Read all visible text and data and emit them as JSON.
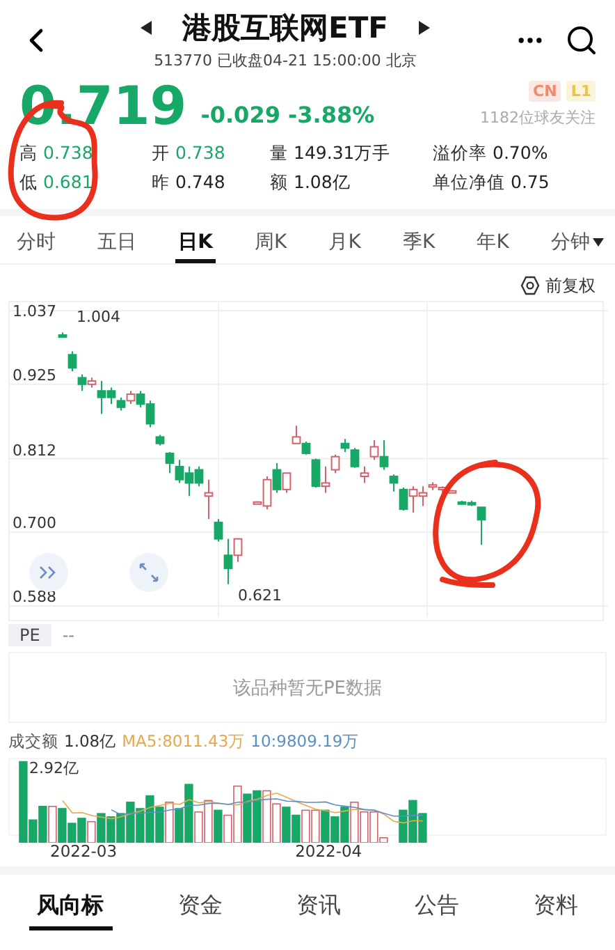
{
  "header": {
    "title": "港股互联网ETF",
    "subtitle": "513770 已收盘04-21 15:00:00 北京"
  },
  "quote": {
    "price": "0.719",
    "change": "-0.029",
    "change_pct": "-3.88%",
    "followers": "1182位球友关注",
    "badges": [
      {
        "label": "CN",
        "color": "#f08a6c"
      },
      {
        "label": "L1",
        "color": "#e9c545"
      }
    ]
  },
  "stats": [
    {
      "label": "高",
      "value": "0.738",
      "color": "#17a868"
    },
    {
      "label": "开",
      "value": "0.738",
      "color": "#17a868"
    },
    {
      "label": "量",
      "value": "149.31万手",
      "color": "#222222"
    },
    {
      "label": "溢价率",
      "value": "0.70%",
      "color": "#222222"
    },
    {
      "label": "低",
      "value": "0.681",
      "color": "#17a868"
    },
    {
      "label": "昨",
      "value": "0.748",
      "color": "#222222"
    },
    {
      "label": "额",
      "value": "1.08亿",
      "color": "#222222"
    },
    {
      "label": "单位净值",
      "value": "0.75",
      "color": "#222222"
    }
  ],
  "period_tabs": [
    {
      "label": "分时",
      "selected": false,
      "kind": "plain"
    },
    {
      "label": "五日",
      "selected": false,
      "kind": "plain"
    },
    {
      "label": "日K",
      "selected": true,
      "kind": "plain"
    },
    {
      "label": "周K",
      "selected": false,
      "kind": "plain"
    },
    {
      "label": "月K",
      "selected": false,
      "kind": "plain"
    },
    {
      "label": "季K",
      "selected": false,
      "kind": "plain"
    },
    {
      "label": "年K",
      "selected": false,
      "kind": "plain"
    },
    {
      "label": "分钟",
      "selected": false,
      "kind": "dropdown"
    }
  ],
  "chart": {
    "adjust": "前复权",
    "high_mark": "1.004",
    "low_mark": "0.621",
    "chart_data": {
      "type": "candlestick",
      "grid": true,
      "ylim": [
        0.588,
        1.037
      ],
      "yticks": [
        {
          "value": 1.037,
          "label": "1.037"
        },
        {
          "value": 0.925,
          "label": "0.925"
        },
        {
          "value": 0.812,
          "label": "0.812"
        },
        {
          "value": 0.7,
          "label": "0.700"
        },
        {
          "value": 0.588,
          "label": "0.588"
        }
      ],
      "ohlc": [
        [
          1.0,
          1.004,
          0.996,
          1.0
        ],
        [
          0.97,
          0.975,
          0.945,
          0.95
        ],
        [
          0.935,
          0.94,
          0.915,
          0.925
        ],
        [
          0.925,
          0.935,
          0.92,
          0.93
        ],
        [
          0.915,
          0.93,
          0.88,
          0.905
        ],
        [
          0.915,
          0.92,
          0.895,
          0.905
        ],
        [
          0.9,
          0.905,
          0.885,
          0.89
        ],
        [
          0.9,
          0.915,
          0.895,
          0.91
        ],
        [
          0.91,
          0.915,
          0.89,
          0.895
        ],
        [
          0.895,
          0.9,
          0.86,
          0.865
        ],
        [
          0.845,
          0.848,
          0.832,
          0.835
        ],
        [
          0.82,
          0.822,
          0.79,
          0.805
        ],
        [
          0.8,
          0.81,
          0.775,
          0.78
        ],
        [
          0.79,
          0.8,
          0.755,
          0.775
        ],
        [
          0.795,
          0.8,
          0.77,
          0.775
        ],
        [
          0.755,
          0.78,
          0.72,
          0.76
        ],
        [
          0.715,
          0.72,
          0.686,
          0.69
        ],
        [
          0.665,
          0.69,
          0.621,
          0.645
        ],
        [
          0.665,
          0.69,
          0.655,
          0.69
        ],
        null,
        [
          0.745,
          0.747,
          0.743,
          0.746
        ],
        [
          0.74,
          0.785,
          0.735,
          0.78
        ],
        [
          0.795,
          0.805,
          0.76,
          0.765
        ],
        [
          0.765,
          0.79,
          0.76,
          0.79
        ],
        [
          0.835,
          0.862,
          0.835,
          0.845
        ],
        [
          0.835,
          0.838,
          0.818,
          0.82
        ],
        [
          0.81,
          0.812,
          0.768,
          0.77
        ],
        [
          0.77,
          0.8,
          0.76,
          0.775
        ],
        [
          0.795,
          0.818,
          0.79,
          0.815
        ],
        [
          0.835,
          0.842,
          0.822,
          0.828
        ],
        [
          0.825,
          0.828,
          0.798,
          0.8
        ],
        [
          0.785,
          0.8,
          0.775,
          0.79
        ],
        [
          0.815,
          0.84,
          0.81,
          0.83
        ],
        [
          0.815,
          0.84,
          0.795,
          0.8
        ],
        [
          0.785,
          0.788,
          0.762,
          0.775
        ],
        [
          0.765,
          0.768,
          0.733,
          0.735
        ],
        [
          0.755,
          0.77,
          0.73,
          0.765
        ],
        [
          0.755,
          0.77,
          0.74,
          0.76
        ],
        [
          0.77,
          0.776,
          0.764,
          0.772
        ],
        [
          0.765,
          0.77,
          0.76,
          0.768
        ],
        [
          0.762,
          0.764,
          0.76,
          0.763
        ],
        [
          0.746,
          0.748,
          0.742,
          0.744
        ],
        [
          0.745,
          0.748,
          0.74,
          0.745
        ],
        [
          0.738,
          0.738,
          0.681,
          0.719
        ]
      ]
    }
  },
  "pe": {
    "label": "PE",
    "value": "--",
    "empty_message": "该品种暂无PE数据"
  },
  "volume": {
    "label": "成交额",
    "value": "1.08亿",
    "ma5": "MA5:8011.43万",
    "ma10": "10:9809.19万",
    "max_label": "2.92亿",
    "dates": [
      "2022-03",
      "2022-04"
    ]
  },
  "bottom_tabs": [
    {
      "label": "风向标",
      "selected": true
    },
    {
      "label": "资金",
      "selected": false
    },
    {
      "label": "资讯",
      "selected": false
    },
    {
      "label": "公告",
      "selected": false
    },
    {
      "label": "资料",
      "selected": false
    }
  ],
  "annotations": {
    "stats_circled": true,
    "chart_circled": true
  }
}
